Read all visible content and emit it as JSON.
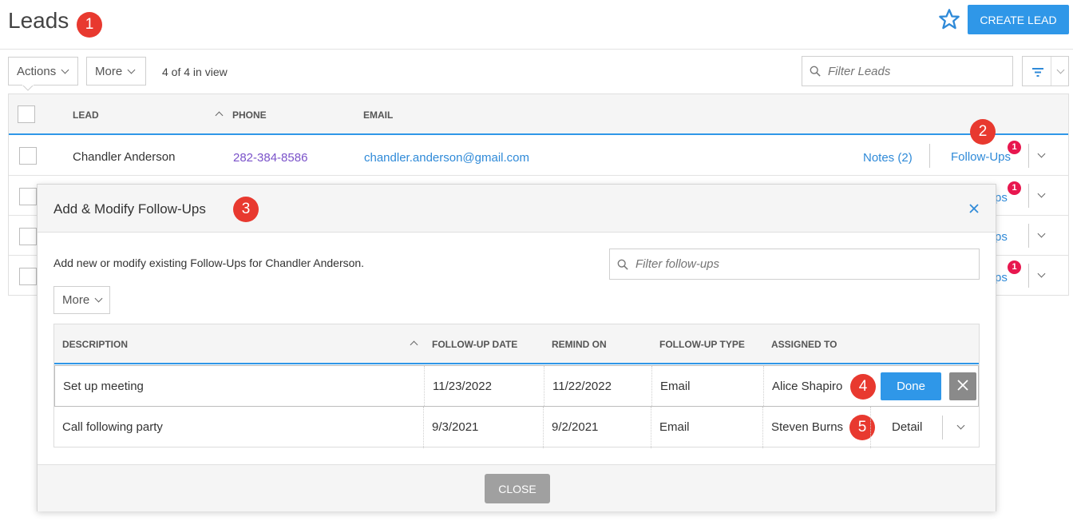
{
  "header": {
    "title": "Leads",
    "create_label": "CREATE LEAD"
  },
  "callouts": [
    "1",
    "2",
    "3",
    "4",
    "5"
  ],
  "toolbar": {
    "actions_label": "Actions",
    "more_label": "More",
    "in_view": "4 of 4 in view",
    "filter_placeholder": "Filter Leads"
  },
  "leads_table": {
    "columns": [
      "LEAD",
      "PHONE",
      "EMAIL"
    ],
    "first_row": {
      "name": "Chandler Anderson",
      "phone": "282-384-8586",
      "email": "chandler.anderson@gmail.com",
      "notes": "Notes (2)",
      "followups": "Follow-Ups",
      "followups_count": "1"
    },
    "partial_rows": [
      {
        "text": "ps",
        "count": "1"
      },
      {
        "text": "ps",
        "count": ""
      },
      {
        "text": "ps",
        "count": "1"
      }
    ]
  },
  "modal": {
    "title": "Add & Modify Follow-Ups",
    "description": "Add new or modify existing Follow-Ups for Chandler Anderson.",
    "filter_placeholder": "Filter follow-ups",
    "more_label": "More",
    "columns": [
      "DESCRIPTION",
      "FOLLOW-UP DATE",
      "REMIND ON",
      "FOLLOW-UP TYPE",
      "ASSIGNED TO"
    ],
    "rows": [
      {
        "description": "Set up meeting",
        "followup_date": "11/23/2022",
        "remind_on": "11/22/2022",
        "type": "Email",
        "assigned_to": "Alice Shapiro",
        "action": "Done"
      },
      {
        "description": "Call following party",
        "followup_date": "9/3/2021",
        "remind_on": "9/2/2021",
        "type": "Email",
        "assigned_to": "Steven Burns",
        "action": "Detail"
      }
    ],
    "close_label": "CLOSE"
  },
  "colors": {
    "accent": "#2f97e8",
    "callout": "#e8392f",
    "notification": "#e8174f",
    "phone": "#7a52c9"
  }
}
